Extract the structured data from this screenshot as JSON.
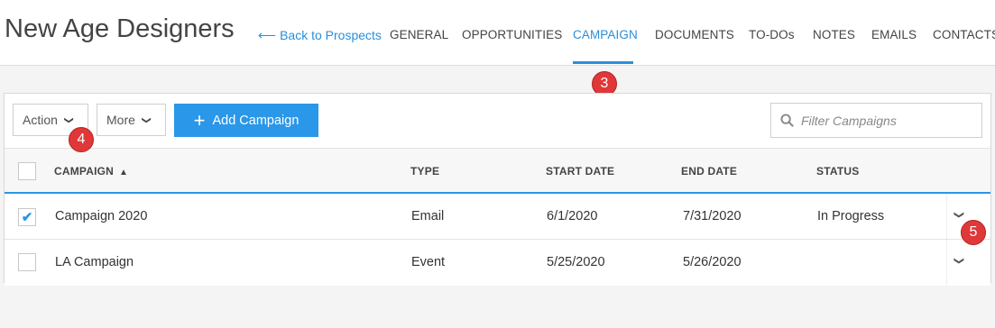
{
  "header": {
    "title": "New Age Designers",
    "back_link": "Back to Prospects",
    "back_arrow": "⟵",
    "tabs": [
      {
        "label": "GENERAL",
        "active": false
      },
      {
        "label": "OPPORTUNITIES",
        "active": false
      },
      {
        "label": "CAMPAIGN",
        "active": true
      },
      {
        "label": "DOCUMENTS",
        "active": false
      },
      {
        "label": "TO-DOs",
        "active": false
      },
      {
        "label": "NOTES",
        "active": false
      },
      {
        "label": "EMAILS",
        "active": false
      },
      {
        "label": "CONTACTS",
        "active": false
      }
    ]
  },
  "markers": [
    "3",
    "4",
    "5"
  ],
  "toolbar": {
    "action_label": "Action",
    "more_label": "More",
    "add_label": "Add Campaign",
    "filter_placeholder": "Filter Campaigns"
  },
  "table": {
    "columns": [
      "CAMPAIGN",
      "TYPE",
      "START DATE",
      "END DATE",
      "STATUS"
    ],
    "rows": [
      {
        "checked": true,
        "campaign": "Campaign 2020",
        "type": "Email",
        "start": "6/1/2020",
        "end": "7/31/2020",
        "status": "In Progress"
      },
      {
        "checked": false,
        "campaign": "LA Campaign",
        "type": "Event",
        "start": "5/25/2020",
        "end": "5/26/2020",
        "status": ""
      }
    ]
  },
  "colors": {
    "accent": "#2a97e8",
    "marker": "#e03838"
  }
}
